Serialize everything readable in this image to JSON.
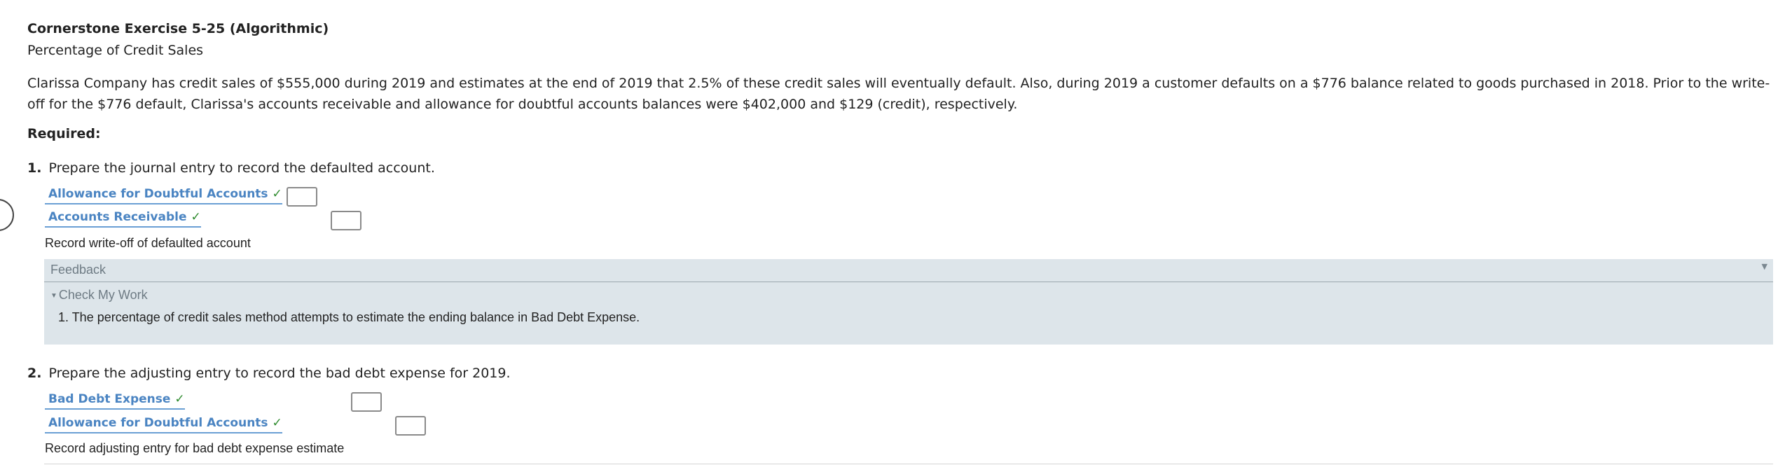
{
  "header": {
    "title": "Cornerstone Exercise 5-25 (Algorithmic)",
    "subtitle": "Percentage of Credit Sales"
  },
  "problem": {
    "text": "Clarissa Company has credit sales of $555,000 during 2019 and estimates at the end of 2019 that 2.5% of these credit sales will eventually default. Also, during 2019 a customer defaults on a $776 balance related to goods purchased in 2018. Prior to the write-off for the $776 default, Clarissa's accounts receivable and allowance for doubtful accounts balances were $402,000 and $129 (credit), respectively.",
    "required_label": "Required:"
  },
  "questions": [
    {
      "number": "1.",
      "prompt": "Prepare the journal entry to record the defaulted account.",
      "entries": [
        {
          "account": "Allowance for Doubtful Accounts",
          "check": "✓",
          "amount": ""
        },
        {
          "account": "Accounts Receivable",
          "check": "✓",
          "amount": ""
        }
      ],
      "memo": "Record write-off of defaulted account"
    },
    {
      "number": "2.",
      "prompt": "Prepare the adjusting entry to record the bad debt expense for 2019.",
      "entries": [
        {
          "account": "Bad Debt Expense",
          "check": "✓",
          "amount": ""
        },
        {
          "account": "Allowance for Doubtful Accounts",
          "check": "✓",
          "amount": ""
        }
      ],
      "memo": "Record adjusting entry for bad debt expense estimate"
    }
  ],
  "feedback": {
    "title": "Feedback",
    "arrow": "▼",
    "check_my_work_arrow": "▼",
    "check_my_work": "Check My Work",
    "text": "1. The percentage of credit sales method attempts to estimate the ending balance in Bad Debt Expense."
  },
  "colors": {
    "account_link": "#4a84c2",
    "check_mark": "#2e8b2e",
    "feedback_bg": "#dde5ea"
  }
}
